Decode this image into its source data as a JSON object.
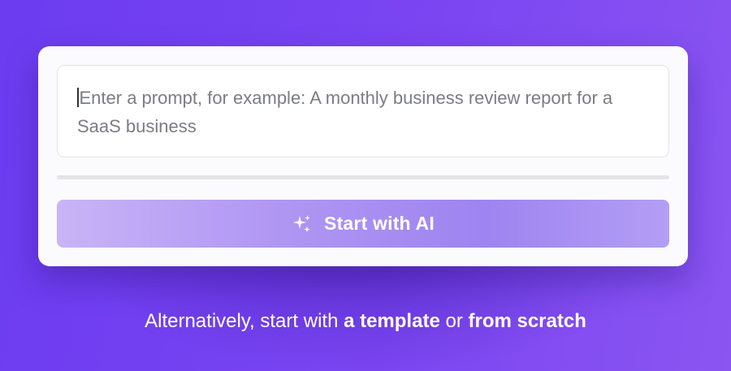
{
  "prompt": {
    "placeholder": "Enter a prompt, for example: A monthly business review report for a SaaS business"
  },
  "ai_button": {
    "label": "Start with AI",
    "icon": "sparkle-icon"
  },
  "footer": {
    "prefix": "Alternatively, start with ",
    "template_link": "a template",
    "connector": " or ",
    "scratch_link": "from scratch"
  },
  "colors": {
    "background_start": "#6b3cf0",
    "background_end": "#8a55f1",
    "card": "#fbfbfd",
    "button_start": "#c9b4f6",
    "button_end": "#9d84f0"
  }
}
